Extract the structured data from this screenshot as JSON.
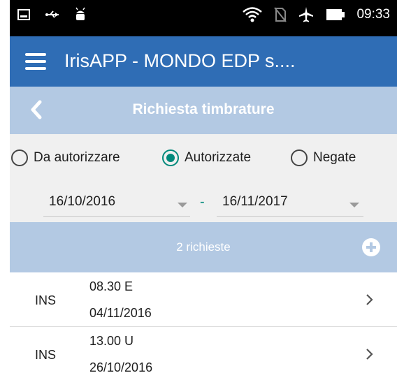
{
  "status_bar": {
    "time": "09:33",
    "left_icons": [
      "image-icon",
      "usb-icon",
      "android-icon"
    ],
    "right_icons": [
      "wifi-icon",
      "no-sim-icon",
      "airplane-icon",
      "battery-icon"
    ]
  },
  "app_bar": {
    "title": "IrisAPP - MONDO EDP s....",
    "color": "#2f6db5"
  },
  "sub_header": {
    "title": "Richiesta timbrature",
    "color": "#b3c9e3"
  },
  "filters": {
    "options": [
      {
        "label": "Da autorizzare",
        "checked": false
      },
      {
        "label": "Autorizzate",
        "checked": true
      },
      {
        "label": "Negate",
        "checked": false
      }
    ],
    "accent": "#00897b",
    "date_from": "16/10/2016",
    "separator": "-",
    "date_to": "16/11/2017"
  },
  "summary": {
    "count_label": "2 richieste"
  },
  "requests": [
    {
      "type": "INS",
      "time": "08.30 E",
      "date": "04/11/2016"
    },
    {
      "type": "INS",
      "time": "13.00 U",
      "date": "26/10/2016"
    }
  ]
}
